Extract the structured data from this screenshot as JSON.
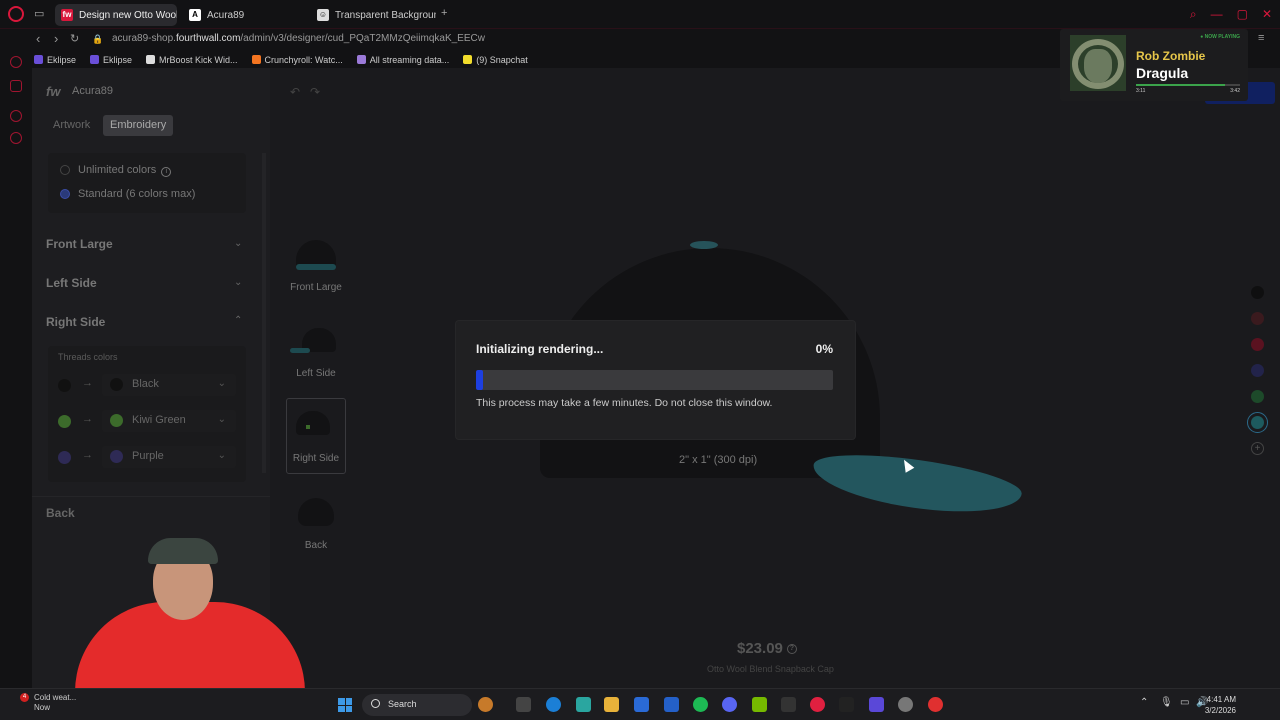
{
  "browser": {
    "tabs": [
      {
        "label": "Design new Otto Wool Ble",
        "favicon": "fw",
        "active": true
      },
      {
        "label": "Acura89",
        "favicon": "A",
        "active": false
      },
      {
        "label": "Transparent Background",
        "favicon": "☺",
        "active": false
      }
    ],
    "new_tab": "+",
    "url_prefix": "acura89-shop.",
    "url_domain": "fourthwall.com",
    "url_path": "/admin/v3/designer/cud_PQaT2MMzQeiimqkaK_EECw",
    "bookmarks": [
      "Eklipse",
      "Eklipse",
      "MrBoost Kick Wid...",
      "Crunchyroll: Watc...",
      "All streaming data...",
      "(9) Snapchat"
    ],
    "bookmark_colors": [
      "#6a4fd8",
      "#6a4fd8",
      "#dddddd",
      "#f47521",
      "#9b7ad8",
      "#f2dd2c"
    ]
  },
  "designer": {
    "brand": "fw",
    "store_name": "Acura89",
    "mode_tabs": [
      "Artwork",
      "Embroidery"
    ],
    "active_mode": "Embroidery",
    "options": [
      {
        "label": "Unlimited colors",
        "selected": false
      },
      {
        "label": "Standard (6 colors max)",
        "selected": true
      }
    ],
    "sections": [
      "Front Large",
      "Left Side",
      "Right Side"
    ],
    "expanded_section": "Right Side",
    "threads_title": "Threads colors",
    "threads": [
      {
        "from_color": "#111111",
        "to_color": "#111111",
        "name": "Black"
      },
      {
        "from_color": "#3c6b2b",
        "to_color": "#3c6b2b",
        "name": "Kiwi Green"
      },
      {
        "from_color": "#2e2a55",
        "to_color": "#2e2a55",
        "name": "Purple"
      }
    ],
    "back_section": "Back",
    "views": [
      "Front Large",
      "Left Side",
      "Right Side",
      "Back"
    ],
    "selected_view": "Right Side",
    "dimension_label": "2\" x 1\" (300 dpi)",
    "price": "$23.09",
    "product_name": "Otto Wool Blend Snapback Cap",
    "swatch_colors": [
      "#0f0f10",
      "#3a1a1e",
      "#5a1220",
      "#22234a",
      "#1d4a2a",
      "#1d5a5e"
    ],
    "cap_accent_color": "#23565e"
  },
  "modal": {
    "title": "Initializing rendering...",
    "percent_label": "0%",
    "progress_fraction": 0.02,
    "note": "This process may take a few minutes. Do not close this window."
  },
  "now_playing": {
    "badge": "● NOW PLAYING",
    "artist": "Rob Zombie",
    "song": "Dragula",
    "elapsed": "3:11",
    "duration": "3:42",
    "progress_fraction": 0.86
  },
  "taskbar": {
    "weather_label": "Cold weat...",
    "weather_sub": "Now",
    "weather_badge": "4",
    "search_placeholder": "Search",
    "time": "4:41 AM",
    "date": "3/2/2026"
  }
}
